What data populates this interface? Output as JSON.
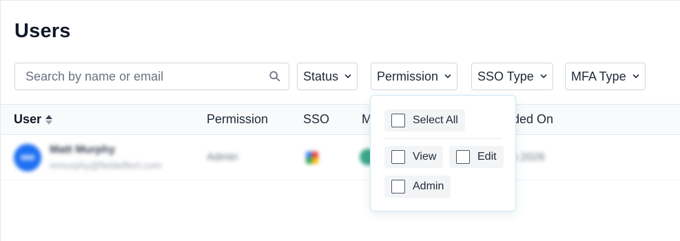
{
  "page": {
    "title": "Users"
  },
  "search": {
    "placeholder": "Search by name or email",
    "value": ""
  },
  "filters": {
    "status": "Status",
    "permission": "Permission",
    "sso_type": "SSO Type",
    "mfa_type": "MFA Type"
  },
  "table": {
    "headers": {
      "user": "User",
      "permission": "Permission",
      "sso": "SSO",
      "mfa": "M",
      "added_on": "dded On"
    },
    "sort": {
      "column": "User",
      "direction": "ascending"
    },
    "rows": [
      {
        "initials": "MM",
        "name": "Matt Murphy",
        "email": "mmurphy@fieldeffect.com",
        "permission": "Admin",
        "added_on": "eb 2026"
      }
    ]
  },
  "permission_dropdown": {
    "open": true,
    "select_all": "Select All",
    "options": [
      "View",
      "Edit",
      "Admin"
    ]
  },
  "colors": {
    "avatar": "#1d6ff2",
    "mfa_badge": "#3aa78a",
    "dropdown_border": "#cfe6f3"
  }
}
